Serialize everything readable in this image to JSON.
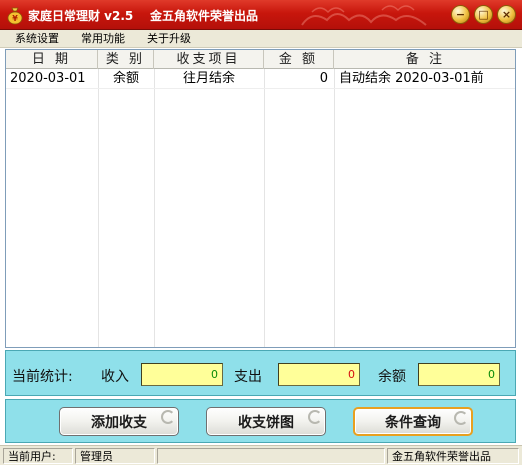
{
  "window": {
    "title": "家庭日常理财 v2.5    金五角软件荣誉出品",
    "icon": "money-bag-icon",
    "minimize_label": "−",
    "maximize_label": "□",
    "close_label": "×"
  },
  "menu": {
    "items": [
      {
        "label": "系统设置"
      },
      {
        "label": "常用功能"
      },
      {
        "label": "关于升级"
      }
    ]
  },
  "table": {
    "headers": [
      "日 期",
      "类 别",
      "收支项目",
      "金 额",
      "备  注"
    ],
    "rows": [
      {
        "date": "2020-03-01",
        "category": "余额",
        "item": "往月结余",
        "amount": "0",
        "note": "自动结余 2020-03-01前"
      }
    ]
  },
  "stats": {
    "label": "当前统计:",
    "income_label": "收入",
    "income_value": "0",
    "expense_label": "支出",
    "expense_value": "0",
    "balance_label": "余额",
    "balance_value": "0"
  },
  "actions": {
    "add": "添加收支",
    "pie": "收支饼图",
    "query": "条件查询"
  },
  "statusbar": {
    "user_label": "当前用户:",
    "user_value": "管理员",
    "credit": "金五角软件荣誉出品"
  },
  "colors": {
    "title_bar": "#c8160c",
    "panel_bg": "#8fe0ea",
    "stat_box": "#ffff99",
    "income_value": "#0a8a0a",
    "expense_value": "#d41010"
  }
}
